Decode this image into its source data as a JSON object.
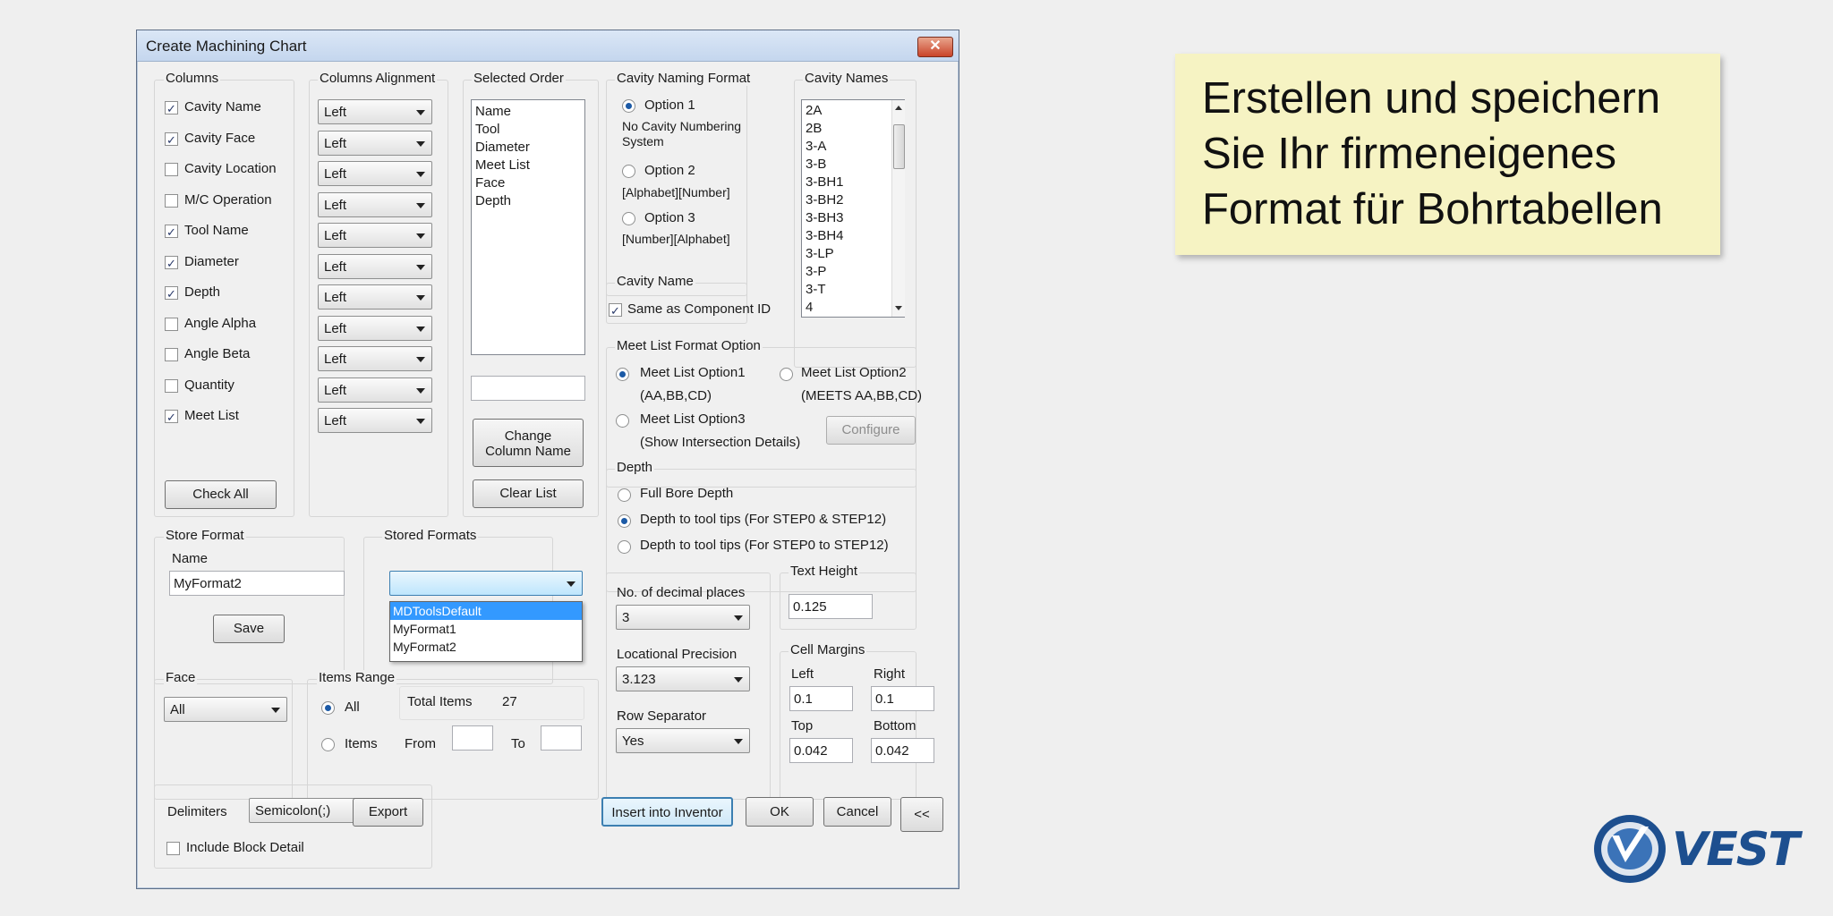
{
  "dialog": {
    "title": "Create Machining Chart",
    "close_label": "✕",
    "columns": {
      "label": "Columns",
      "items": [
        {
          "label": "Cavity Name",
          "checked": true
        },
        {
          "label": "Cavity Face",
          "checked": true
        },
        {
          "label": "Cavity Location",
          "checked": false
        },
        {
          "label": "M/C Operation",
          "checked": false
        },
        {
          "label": "Tool Name",
          "checked": true
        },
        {
          "label": "Diameter",
          "checked": true
        },
        {
          "label": "Depth",
          "checked": true
        },
        {
          "label": "Angle Alpha",
          "checked": false
        },
        {
          "label": "Angle Beta",
          "checked": false
        },
        {
          "label": "Quantity",
          "checked": false
        },
        {
          "label": "Meet List",
          "checked": true
        }
      ],
      "check_all_label": "Check All"
    },
    "alignment": {
      "label": "Columns Alignment",
      "values": [
        "Left",
        "Left",
        "Left",
        "Left",
        "Left",
        "Left",
        "Left",
        "Left",
        "Left",
        "Left",
        "Left"
      ]
    },
    "selected_order": {
      "label": "Selected Order",
      "items": [
        "Name",
        "Tool",
        "Diameter",
        "Meet List",
        "Face",
        "Depth"
      ],
      "input_value": "",
      "change_label_line1": "Change",
      "change_label_line2": "Column Name",
      "clear_label": "Clear List"
    },
    "cavity_naming": {
      "label": "Cavity Naming Format",
      "option1": "Option 1",
      "option1_desc_line1": "No Cavity Numbering",
      "option1_desc_line2": "System",
      "option2": "Option 2",
      "option2_desc": "[Alphabet][Number]",
      "option3": "Option 3",
      "option3_desc": "[Number][Alphabet]",
      "selected": 1
    },
    "cavity_names": {
      "label": "Cavity Names",
      "items": [
        "2A",
        "2B",
        "3-A",
        "3-B",
        "3-BH1",
        "3-BH2",
        "3-BH3",
        "3-BH4",
        "3-LP",
        "3-P",
        "3-T",
        "4"
      ]
    },
    "cavity_name": {
      "label": "Cavity Name",
      "same_label": "Same as Component ID",
      "checked": true
    },
    "meet_list": {
      "label": "Meet List Format Option",
      "option1": "Meet List Option1",
      "option1_desc": "(AA,BB,CD)",
      "option2": "Meet List Option2",
      "option2_desc": "(MEETS AA,BB,CD)",
      "option3": "Meet List Option3",
      "option3_desc": "(Show Intersection Details)",
      "configure_label": "Configure",
      "selected": 1
    },
    "depth": {
      "label": "Depth",
      "options": [
        "Full Bore Depth",
        "Depth to tool tips (For STEP0 & STEP12)",
        "Depth to tool tips (For STEP0 to STEP12)"
      ],
      "selected": 2
    },
    "store_format": {
      "label": "Store Format",
      "name_label": "Name",
      "name_value": "MyFormat2",
      "save_label": "Save"
    },
    "stored_formats": {
      "label": "Stored Formats",
      "selected_value": "",
      "options": [
        "MDToolsDefault",
        "MyFormat1",
        "MyFormat2"
      ],
      "highlighted": "MDToolsDefault"
    },
    "decimal": {
      "label": "No. of decimal places",
      "value": "3"
    },
    "precision": {
      "label": "Locational Precision",
      "value": "3.123"
    },
    "row_separator": {
      "label": "Row Separator",
      "value": "Yes"
    },
    "text_height": {
      "label": "Text Height",
      "value": "0.125"
    },
    "cell_margins": {
      "label": "Cell Margins",
      "left_label": "Left",
      "left_value": "0.1",
      "right_label": "Right",
      "right_value": "0.1",
      "top_label": "Top",
      "top_value": "0.042",
      "bottom_label": "Bottom",
      "bottom_value": "0.042"
    },
    "face": {
      "label": "Face",
      "value": "All"
    },
    "items_range": {
      "label": "Items Range",
      "all_label": "All",
      "items_label": "Items",
      "total_label": "Total Items",
      "total_value": "27",
      "from_label": "From",
      "to_label": "To",
      "from_value": "",
      "to_value": "",
      "selected": "All"
    },
    "footer": {
      "delimiters_label": "Delimiters",
      "delimiter_value": "Semicolon(;)",
      "export_label": "Export",
      "include_block_label": "Include Block Detail",
      "include_block_checked": false,
      "insert_label": "Insert into Inventor",
      "ok_label": "OK",
      "cancel_label": "Cancel",
      "collapse_label": "<<"
    }
  },
  "note": {
    "line1": "Erstellen und speichern",
    "line2": "Sie Ihr firmeneigenes",
    "line3": "Format für Bohrtabellen"
  },
  "logo": {
    "text": "VEST",
    "colors": {
      "primary": "#1d4f8f",
      "ring": "#3b73b8"
    }
  }
}
